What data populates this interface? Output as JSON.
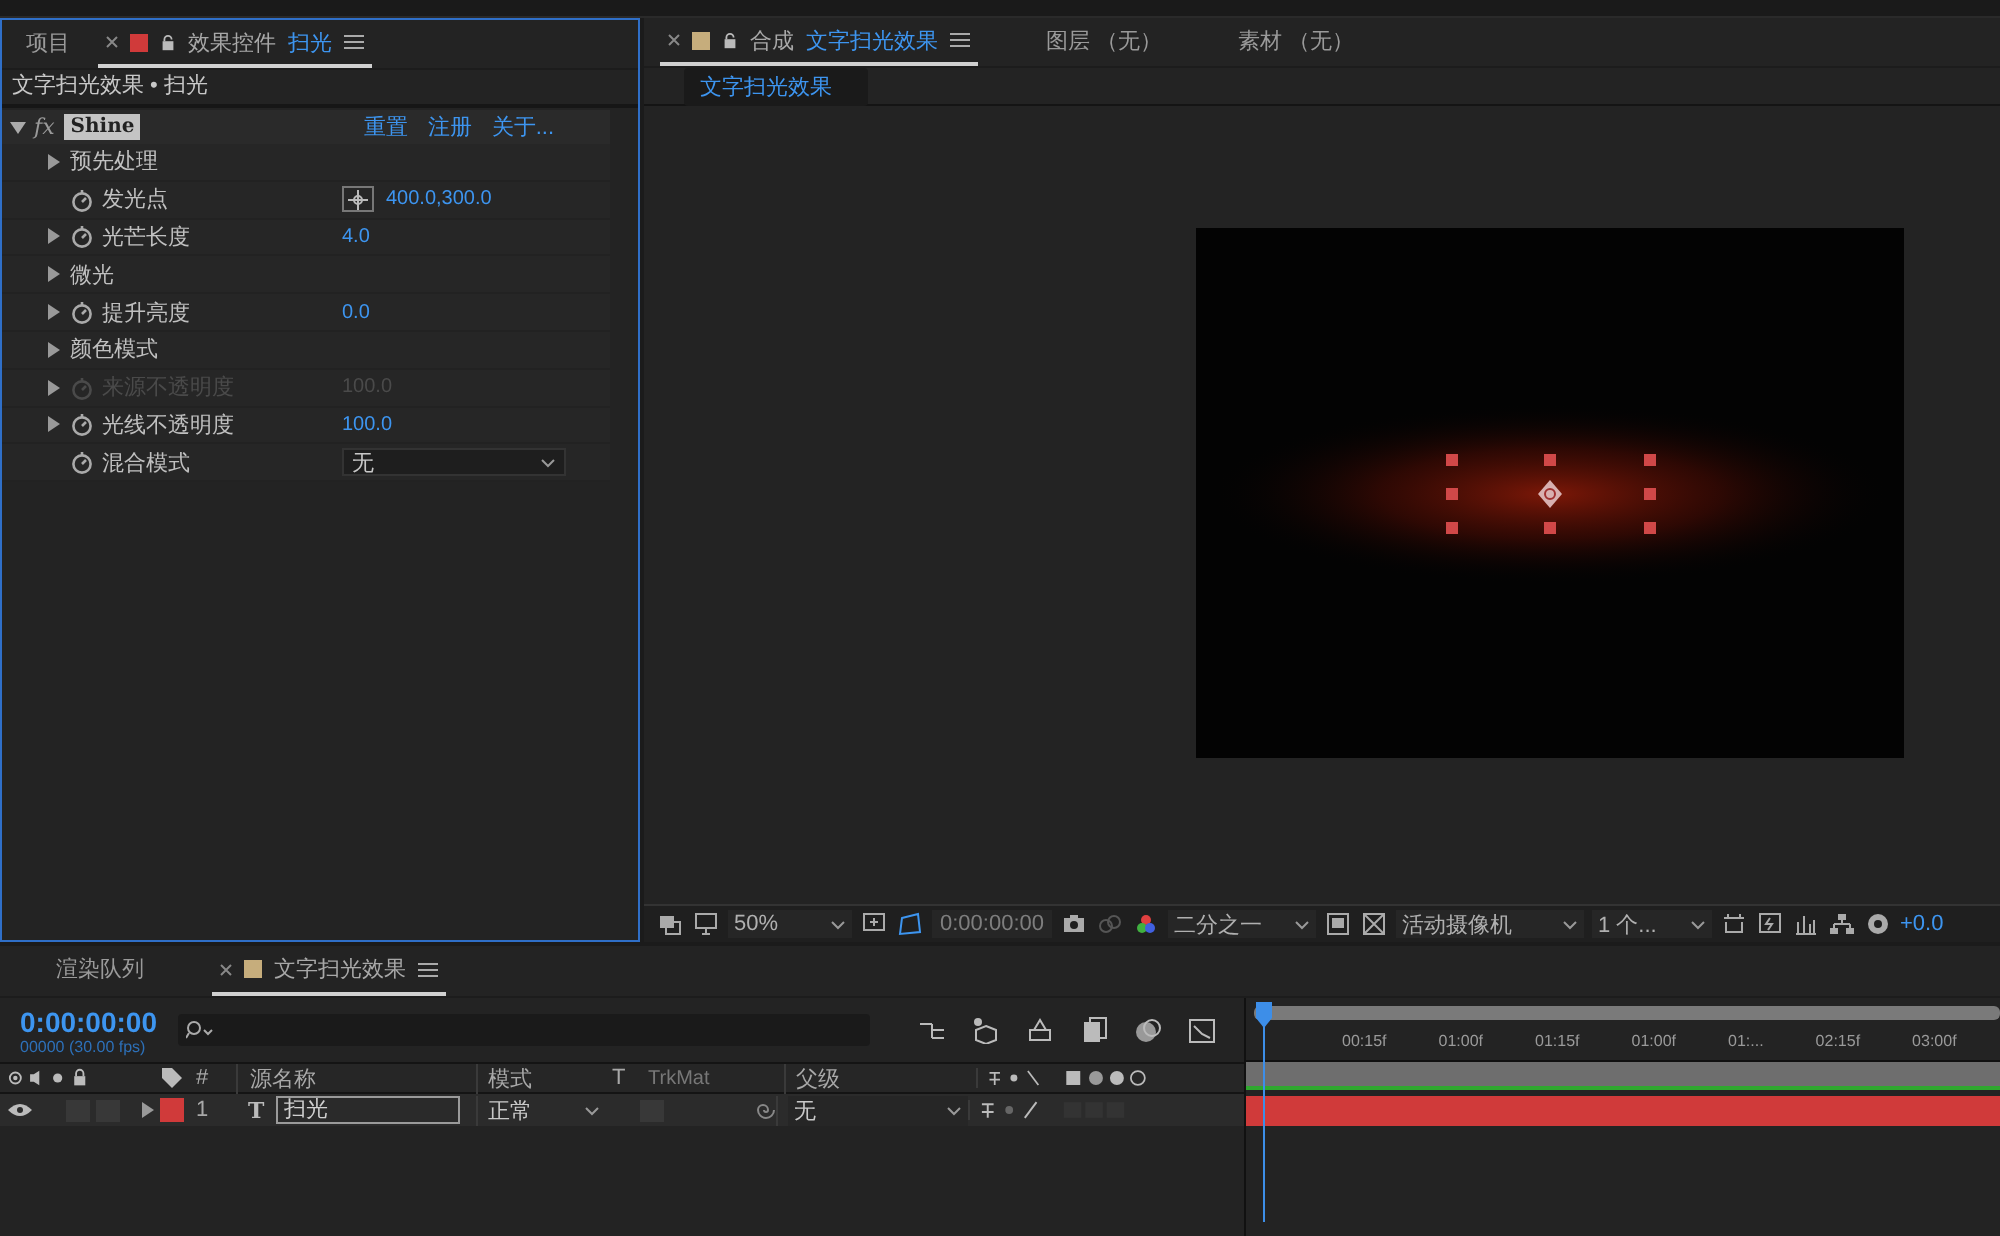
{
  "effects_panel": {
    "tabs": [
      {
        "label": "项目",
        "selected": false
      },
      {
        "label": "效果控件",
        "subject": "扫光",
        "color": "#d03a3a",
        "selected": true
      }
    ],
    "breadcrumb": "文字扫光效果 • 扫光",
    "effect": {
      "glyph": "fx",
      "name": "Shine",
      "expanded": true,
      "links": [
        "重置",
        "注册",
        "关于..."
      ]
    },
    "params": [
      {
        "kind": "group",
        "label": "预先处理",
        "twirl": true,
        "stopwatch": false,
        "disabled": false
      },
      {
        "kind": "point",
        "label": "发光点",
        "value": "400.0,300.0",
        "twirl": false,
        "stopwatch": true,
        "disabled": false
      },
      {
        "kind": "value",
        "label": "光芒长度",
        "value": "4.0",
        "twirl": true,
        "stopwatch": true,
        "disabled": false
      },
      {
        "kind": "group",
        "label": "微光",
        "twirl": true,
        "stopwatch": false,
        "disabled": false
      },
      {
        "kind": "value",
        "label": "提升亮度",
        "value": "0.0",
        "twirl": true,
        "stopwatch": true,
        "disabled": false
      },
      {
        "kind": "group",
        "label": "颜色模式",
        "twirl": true,
        "stopwatch": false,
        "disabled": false
      },
      {
        "kind": "value",
        "label": "来源不透明度",
        "value": "100.0",
        "twirl": true,
        "stopwatch": true,
        "disabled": true
      },
      {
        "kind": "value",
        "label": "光线不透明度",
        "value": "100.0",
        "twirl": true,
        "stopwatch": true,
        "disabled": false
      },
      {
        "kind": "dropdown",
        "label": "混合模式",
        "value": "无",
        "twirl": false,
        "stopwatch": true,
        "disabled": false
      }
    ]
  },
  "comp_panel": {
    "tabs": [
      {
        "label": "合成",
        "subject": "文字扫光效果",
        "color": "#c6ad7c",
        "selected": true
      },
      {
        "label": "图层 （无）",
        "selected": false
      },
      {
        "label": "素材 （无）",
        "selected": false
      }
    ],
    "breadcrumb": "文字扫光效果",
    "toolbar": {
      "zoom": "50%",
      "time": "0:00:00:00",
      "resolution": "二分之一",
      "camera": "活动摄像机",
      "views": "1 个...",
      "exposure": "+0.0"
    }
  },
  "timeline": {
    "tabs": [
      {
        "label": "渲染队列",
        "selected": false
      },
      {
        "label": "文字扫光效果",
        "color": "#c6ad7c",
        "selected": true
      }
    ],
    "timecode": "0:00:00:00",
    "frame_info": "00000 (30.00 fps)",
    "columns": {
      "number": "#",
      "source_name": "源名称",
      "mode": "模式",
      "t": "T",
      "trkmat": "TrkMat",
      "parent": "父级"
    },
    "ruler": [
      "00:15f",
      "01:00f",
      "01:15f",
      "01:00f",
      "01:...",
      "02:15f",
      "03:00f"
    ],
    "layers": [
      {
        "visible": true,
        "expanded": false,
        "color": "#d03a3a",
        "number": "1",
        "type_glyph": "T",
        "name": "扫光",
        "mode": "正常",
        "parent": "无"
      }
    ]
  }
}
